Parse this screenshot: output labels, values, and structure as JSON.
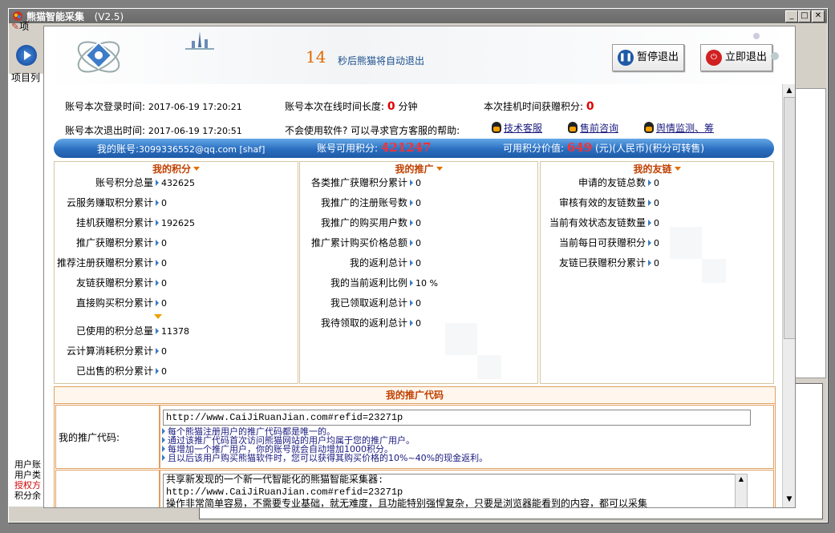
{
  "window": {
    "title": "熊猫智能采集",
    "version": "(V2.5)"
  },
  "behind": {
    "menu_item": "项",
    "tab_label": "项目列",
    "list": [
      "用户账",
      "用户类",
      "授权方",
      "积分余"
    ]
  },
  "header": {
    "countdown": "14",
    "countdown_msg": "秒后熊猫将自动退出",
    "pause_button": "暂停退出",
    "exit_button": "立即退出"
  },
  "info": {
    "login_label": "账号本次登录时间:",
    "login_time": "2017-06-19 17:20:21",
    "online_label": "账号本次在线时间长度:",
    "online_value": "0",
    "online_unit": "分钟",
    "earn_label": "本次挂机时间获赠积分:",
    "earn_value": "0",
    "logout_label": "账号本次退出时间:",
    "logout_time": "2017-06-19 17:20:51",
    "help_text": "不会使用软件? 可以寻求官方客服的帮助:",
    "links": [
      "技术客服",
      "售前咨询",
      "舆情监测、筹"
    ]
  },
  "bar": {
    "account_label": "我的账号:",
    "account": "3099336552@qq.com [shaf]",
    "points_label": "账号可用积分:",
    "points": "421247",
    "value_label": "可用积分价值:",
    "value": "649",
    "value_unit": "(元)(人民币)(积分可转售)"
  },
  "col1": {
    "title": "我的积分",
    "rows": [
      {
        "label": "账号积分总量",
        "value": "432625"
      },
      {
        "label": "云服务赚取积分累计",
        "value": "0"
      },
      {
        "label": "挂机获赠积分累计",
        "value": "192625"
      },
      {
        "label": "推广获赠积分累计",
        "value": "0"
      },
      {
        "label": "推荐注册获赠积分累计",
        "value": "0"
      },
      {
        "label": "友链获赠积分累计",
        "value": "0"
      },
      {
        "label": "直接购买积分累计",
        "value": "0"
      },
      {
        "label": "已使用的积分总量",
        "value": "11378"
      },
      {
        "label": "云计算消耗积分累计",
        "value": "0"
      },
      {
        "label": "已出售的积分累计",
        "value": "0"
      }
    ]
  },
  "col2": {
    "title": "我的推广",
    "rows": [
      {
        "label": "各类推广获赠积分累计",
        "value": "0"
      },
      {
        "label": "我推广的注册账号数",
        "value": "0"
      },
      {
        "label": "我推广的购买用户数",
        "value": "0"
      },
      {
        "label": "推广累计购买价格总额",
        "value": "0"
      },
      {
        "label": "我的返利总计",
        "value": "0"
      },
      {
        "label": "我的当前返利比例",
        "value": "10 %"
      },
      {
        "label": "我已领取返利总计",
        "value": "0"
      },
      {
        "label": "我待领取的返利总计",
        "value": "0"
      }
    ]
  },
  "col3": {
    "title": "我的友链",
    "rows": [
      {
        "label": "申请的友链总数",
        "value": "0"
      },
      {
        "label": "审核有效的友链数量",
        "value": "0"
      },
      {
        "label": "当前有效状态友链数量",
        "value": "0"
      },
      {
        "label": "当前每日可获赠积分",
        "value": "0"
      },
      {
        "label": "友链已获赠积分累计",
        "value": "0"
      }
    ]
  },
  "promo": {
    "title": "我的推广代码",
    "code_label": "我的推广代码:",
    "url": "http://www.CaiJiRuanJian.com#refid=23271p",
    "notes": [
      "每个熊猫注册用户的推广代码都是唯一的。",
      "通过该推广代码首次访问熊猫网站的用户均属于您的推广用户。",
      "每增加一个推广用户，你的账号就会自动增加1000积分。",
      "且以后该用户购买熊猫软件时，您可以获得其购买价格的10%~40%的现金返利。"
    ],
    "share_lines": [
      "共享新发现的一个新一代智能化的熊猫智能采集器:",
      "http://www.CaiJiRuanJian.com#refid=23271p",
      "操作非常简单容易，不需要专业基础，就无难度，且功能特别强悍复杂，只要是浏览器能看到的内容，都可以采集"
    ]
  },
  "colors": {
    "accent": "#e06a00",
    "bar_blue": "#2a6fc0",
    "alert_red": "#e00000"
  }
}
